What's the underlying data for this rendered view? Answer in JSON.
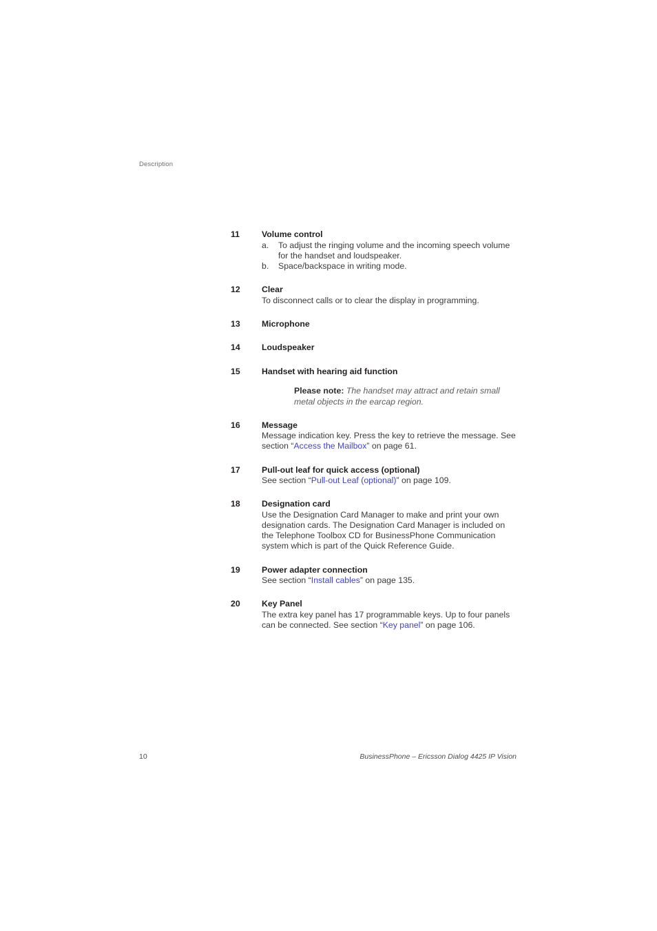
{
  "header": {
    "running_head": "Description"
  },
  "items": [
    {
      "number": "11",
      "title": "Volume control",
      "sublist": [
        {
          "marker": "a.",
          "text": "To adjust the ringing volume and the incoming speech volume for the handset and loudspeaker."
        },
        {
          "marker": "b.",
          "text": "Space/backspace in writing mode."
        }
      ]
    },
    {
      "number": "12",
      "title": "Clear",
      "body": "To disconnect calls or to clear the display in programming."
    },
    {
      "number": "13",
      "title": "Microphone"
    },
    {
      "number": "14",
      "title": "Loudspeaker"
    },
    {
      "number": "15",
      "title": "Handset with hearing aid function",
      "note": {
        "label": "Please note:",
        "text": "The handset may attract and retain small metal objects in the earcap region."
      }
    },
    {
      "number": "16",
      "title": "Message",
      "body_before": "Message indication key. Press the key to retrieve the message. See section “",
      "link": "Access the Mailbox",
      "body_after": "” on page 61."
    },
    {
      "number": "17",
      "title": "Pull-out leaf for quick access (optional)",
      "body_before": "See section “",
      "link": "Pull-out Leaf (optional)",
      "body_after": "” on page 109."
    },
    {
      "number": "18",
      "title": "Designation card",
      "body": "Use the Designation Card Manager to make and print your own designation cards. The Designation Card Manager is included on the Telephone Toolbox CD for BusinessPhone Communication system which is part of the Quick Reference Guide."
    },
    {
      "number": "19",
      "title": "Power adapter connection",
      "body_before": "See section “",
      "link": "Install cables",
      "body_after": "” on page 135."
    },
    {
      "number": "20",
      "title": "Key Panel",
      "body_before": "The extra key panel has 17 programmable keys. Up to four panels can be connected. See section “",
      "link": "Key panel",
      "body_after": "” on page 106."
    }
  ],
  "footer": {
    "page_number": "10",
    "document_title": "BusinessPhone – Ericsson Dialog 4425 IP Vision"
  },
  "colors": {
    "link": "#4040d8",
    "body_text": "#3a3a3a",
    "heading_text": "#231f20",
    "muted_text": "#6c6c6c"
  }
}
